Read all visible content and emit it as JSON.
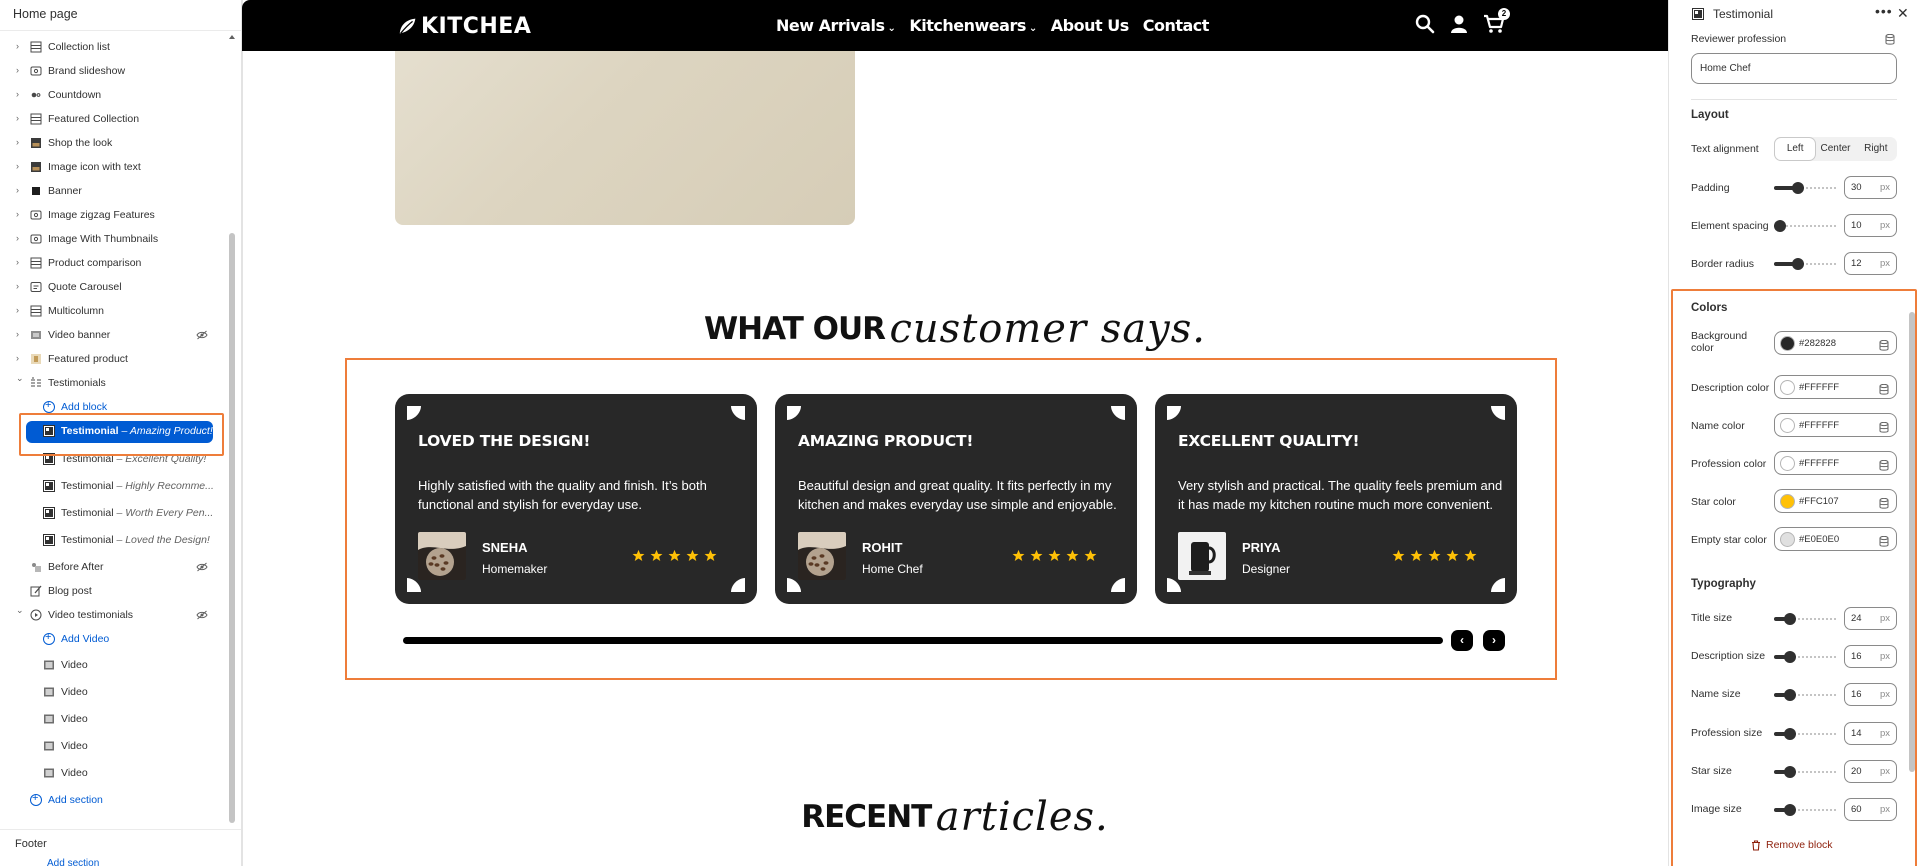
{
  "left_panel": {
    "title": "Home page",
    "items": [
      {
        "label": "Collection list",
        "icon": "grid-icon",
        "chevron": true,
        "hidden": false
      },
      {
        "label": "Brand slideshow",
        "icon": "slideshow-icon",
        "chevron": true,
        "hidden": false
      },
      {
        "label": "Countdown",
        "icon": "countdown-icon",
        "chevron": true,
        "hidden": false
      },
      {
        "label": "Featured Collection",
        "icon": "grid-icon",
        "chevron": true,
        "hidden": false
      },
      {
        "label": "Shop the look",
        "icon": "image-thumb-icon",
        "chevron": true,
        "hidden": false
      },
      {
        "label": "Image icon with text",
        "icon": "image-thumb-icon",
        "chevron": true,
        "hidden": false
      },
      {
        "label": "Banner",
        "icon": "banner-icon",
        "chevron": true,
        "hidden": false
      },
      {
        "label": "Image zigzag Features",
        "icon": "slideshow-icon",
        "chevron": true,
        "hidden": false
      },
      {
        "label": "Image With Thumbnails",
        "icon": "slideshow-icon",
        "chevron": true,
        "hidden": false
      },
      {
        "label": "Product comparison",
        "icon": "grid-icon",
        "chevron": true,
        "hidden": false
      },
      {
        "label": "Quote Carousel",
        "icon": "quote-icon",
        "chevron": true,
        "hidden": false
      },
      {
        "label": "Multicolumn",
        "icon": "grid-icon",
        "chevron": true,
        "hidden": false
      },
      {
        "label": "Video banner",
        "icon": "video-thumb-icon",
        "chevron": true,
        "hidden": true
      },
      {
        "label": "Featured product",
        "icon": "product-thumb-icon",
        "chevron": true,
        "hidden": false
      }
    ],
    "testimonials": {
      "label": "Testimonials",
      "add_block": "Add block",
      "blocks": [
        {
          "label": "Testimonial",
          "sub": "– Amazing Product!",
          "selected": true
        },
        {
          "label": "Testimonial",
          "sub": "– Excellent Quality!",
          "selected": false
        },
        {
          "label": "Testimonial",
          "sub": "– Highly Recomme...",
          "selected": false
        },
        {
          "label": "Testimonial",
          "sub": "– Worth Every Pen...",
          "selected": false
        },
        {
          "label": "Testimonial",
          "sub": "– Loved the Design!",
          "selected": false
        }
      ]
    },
    "after_items": [
      {
        "label": "Before After",
        "icon": "before-after-icon",
        "hidden": true
      },
      {
        "label": "Blog post",
        "icon": "blog-edit-icon",
        "hidden": false
      }
    ],
    "video_testimonials": {
      "label": "Video testimonials",
      "hidden": true,
      "add_video": "Add Video",
      "videos": [
        "Video",
        "Video",
        "Video",
        "Video",
        "Video"
      ]
    },
    "add_section": "Add section",
    "footer": {
      "label": "Footer",
      "add_section": "Add section"
    }
  },
  "store": {
    "logo": "KITCHEA",
    "nav": [
      "New Arrivals",
      "Kitchenwears",
      "About Us",
      "Contact"
    ],
    "nav_dropdown": [
      true,
      true,
      false,
      false
    ],
    "cart_count": "2",
    "testimonial_section": {
      "title_bold": "WHAT OUR",
      "title_script": "customer says.",
      "cards": [
        {
          "title": "LOVED THE DESIGN!",
          "text": "Highly satisfied with the quality and finish. It’s both functional and stylish for everyday use.",
          "name": "SNEHA",
          "profession": "Homemaker",
          "stars": 5,
          "avatar": "coffee-beans"
        },
        {
          "title": "AMAZING PRODUCT!",
          "text": "Beautiful design and great quality. It fits perfectly in my kitchen and makes everyday use simple and enjoyable.",
          "name": "ROHIT",
          "profession": "Home Chef",
          "stars": 5,
          "avatar": "coffee-beans"
        },
        {
          "title": "EXCELLENT QUALITY!",
          "text": "Very stylish and practical. The quality feels premium and it has made my kitchen routine much more convenient.",
          "name": "PRIYA",
          "profession": "Designer",
          "stars": 5,
          "avatar": "kettle"
        }
      ],
      "prev_arrow": "‹",
      "next_arrow": "›"
    },
    "articles_section": {
      "title_bold": "RECENT",
      "title_script": "articles."
    }
  },
  "right_panel": {
    "header_title": "Testimonial",
    "reviewer_profession_label": "Reviewer profession",
    "reviewer_profession_value": "Home Chef",
    "layout": {
      "title": "Layout",
      "text_alignment_label": "Text alignment",
      "alignment_options": [
        "Left",
        "Center",
        "Right"
      ],
      "alignment_selected": "Left",
      "padding_label": "Padding",
      "padding_value": "30",
      "spacing_label": "Element spacing",
      "spacing_value": "10",
      "radius_label": "Border radius",
      "radius_value": "12",
      "unit": "px"
    },
    "colors": {
      "title": "Colors",
      "items": [
        {
          "label": "Background color",
          "hex": "#282828"
        },
        {
          "label": "Description color",
          "hex": "#FFFFFF"
        },
        {
          "label": "Name color",
          "hex": "#FFFFFF"
        },
        {
          "label": "Profession color",
          "hex": "#FFFFFF"
        },
        {
          "label": "Star color",
          "hex": "#FFC107"
        },
        {
          "label": "Empty star color",
          "hex": "#E0E0E0"
        }
      ]
    },
    "typography": {
      "title": "Typography",
      "items": [
        {
          "label": "Title size",
          "value": "24"
        },
        {
          "label": "Description size",
          "value": "16"
        },
        {
          "label": "Name size",
          "value": "16"
        },
        {
          "label": "Profession size",
          "value": "14"
        },
        {
          "label": "Star size",
          "value": "20"
        },
        {
          "label": "Image size",
          "value": "60"
        }
      ],
      "unit": "px"
    },
    "remove_block": "Remove block"
  },
  "colors": {
    "accent_blue": "#005bd3",
    "highlight_orange": "#ee7d3a",
    "star": "#FFC107",
    "card_bg": "#282828"
  }
}
